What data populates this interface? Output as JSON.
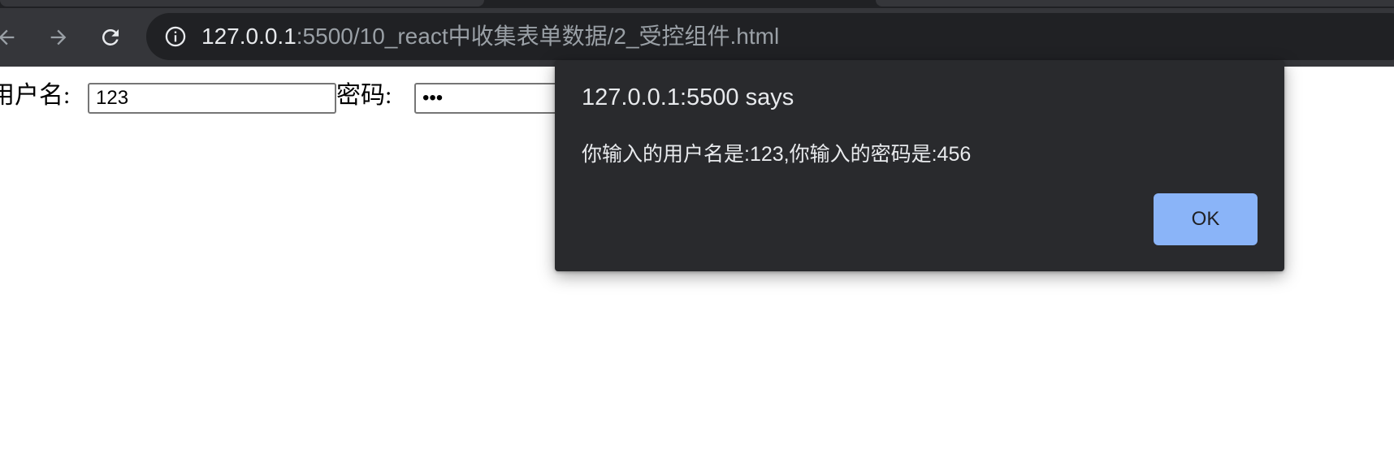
{
  "browser": {
    "url_host": "127.0.0.1",
    "url_path": ":5500/10_react中收集表单数据/2_受控组件.html",
    "icons": {
      "back": "arrow-left",
      "forward": "arrow-right",
      "reload": "reload",
      "site_info": "info-circle"
    }
  },
  "form": {
    "username_label": "用户名:",
    "username_value": "123",
    "password_label": "密码:",
    "password_value": "456"
  },
  "dialog": {
    "title": "127.0.0.1:5500 says",
    "message": "你输入的用户名是:123,你输入的密码是:456",
    "ok_label": "OK",
    "button_color": "#8ab4f8",
    "background_color": "#292a2d"
  }
}
